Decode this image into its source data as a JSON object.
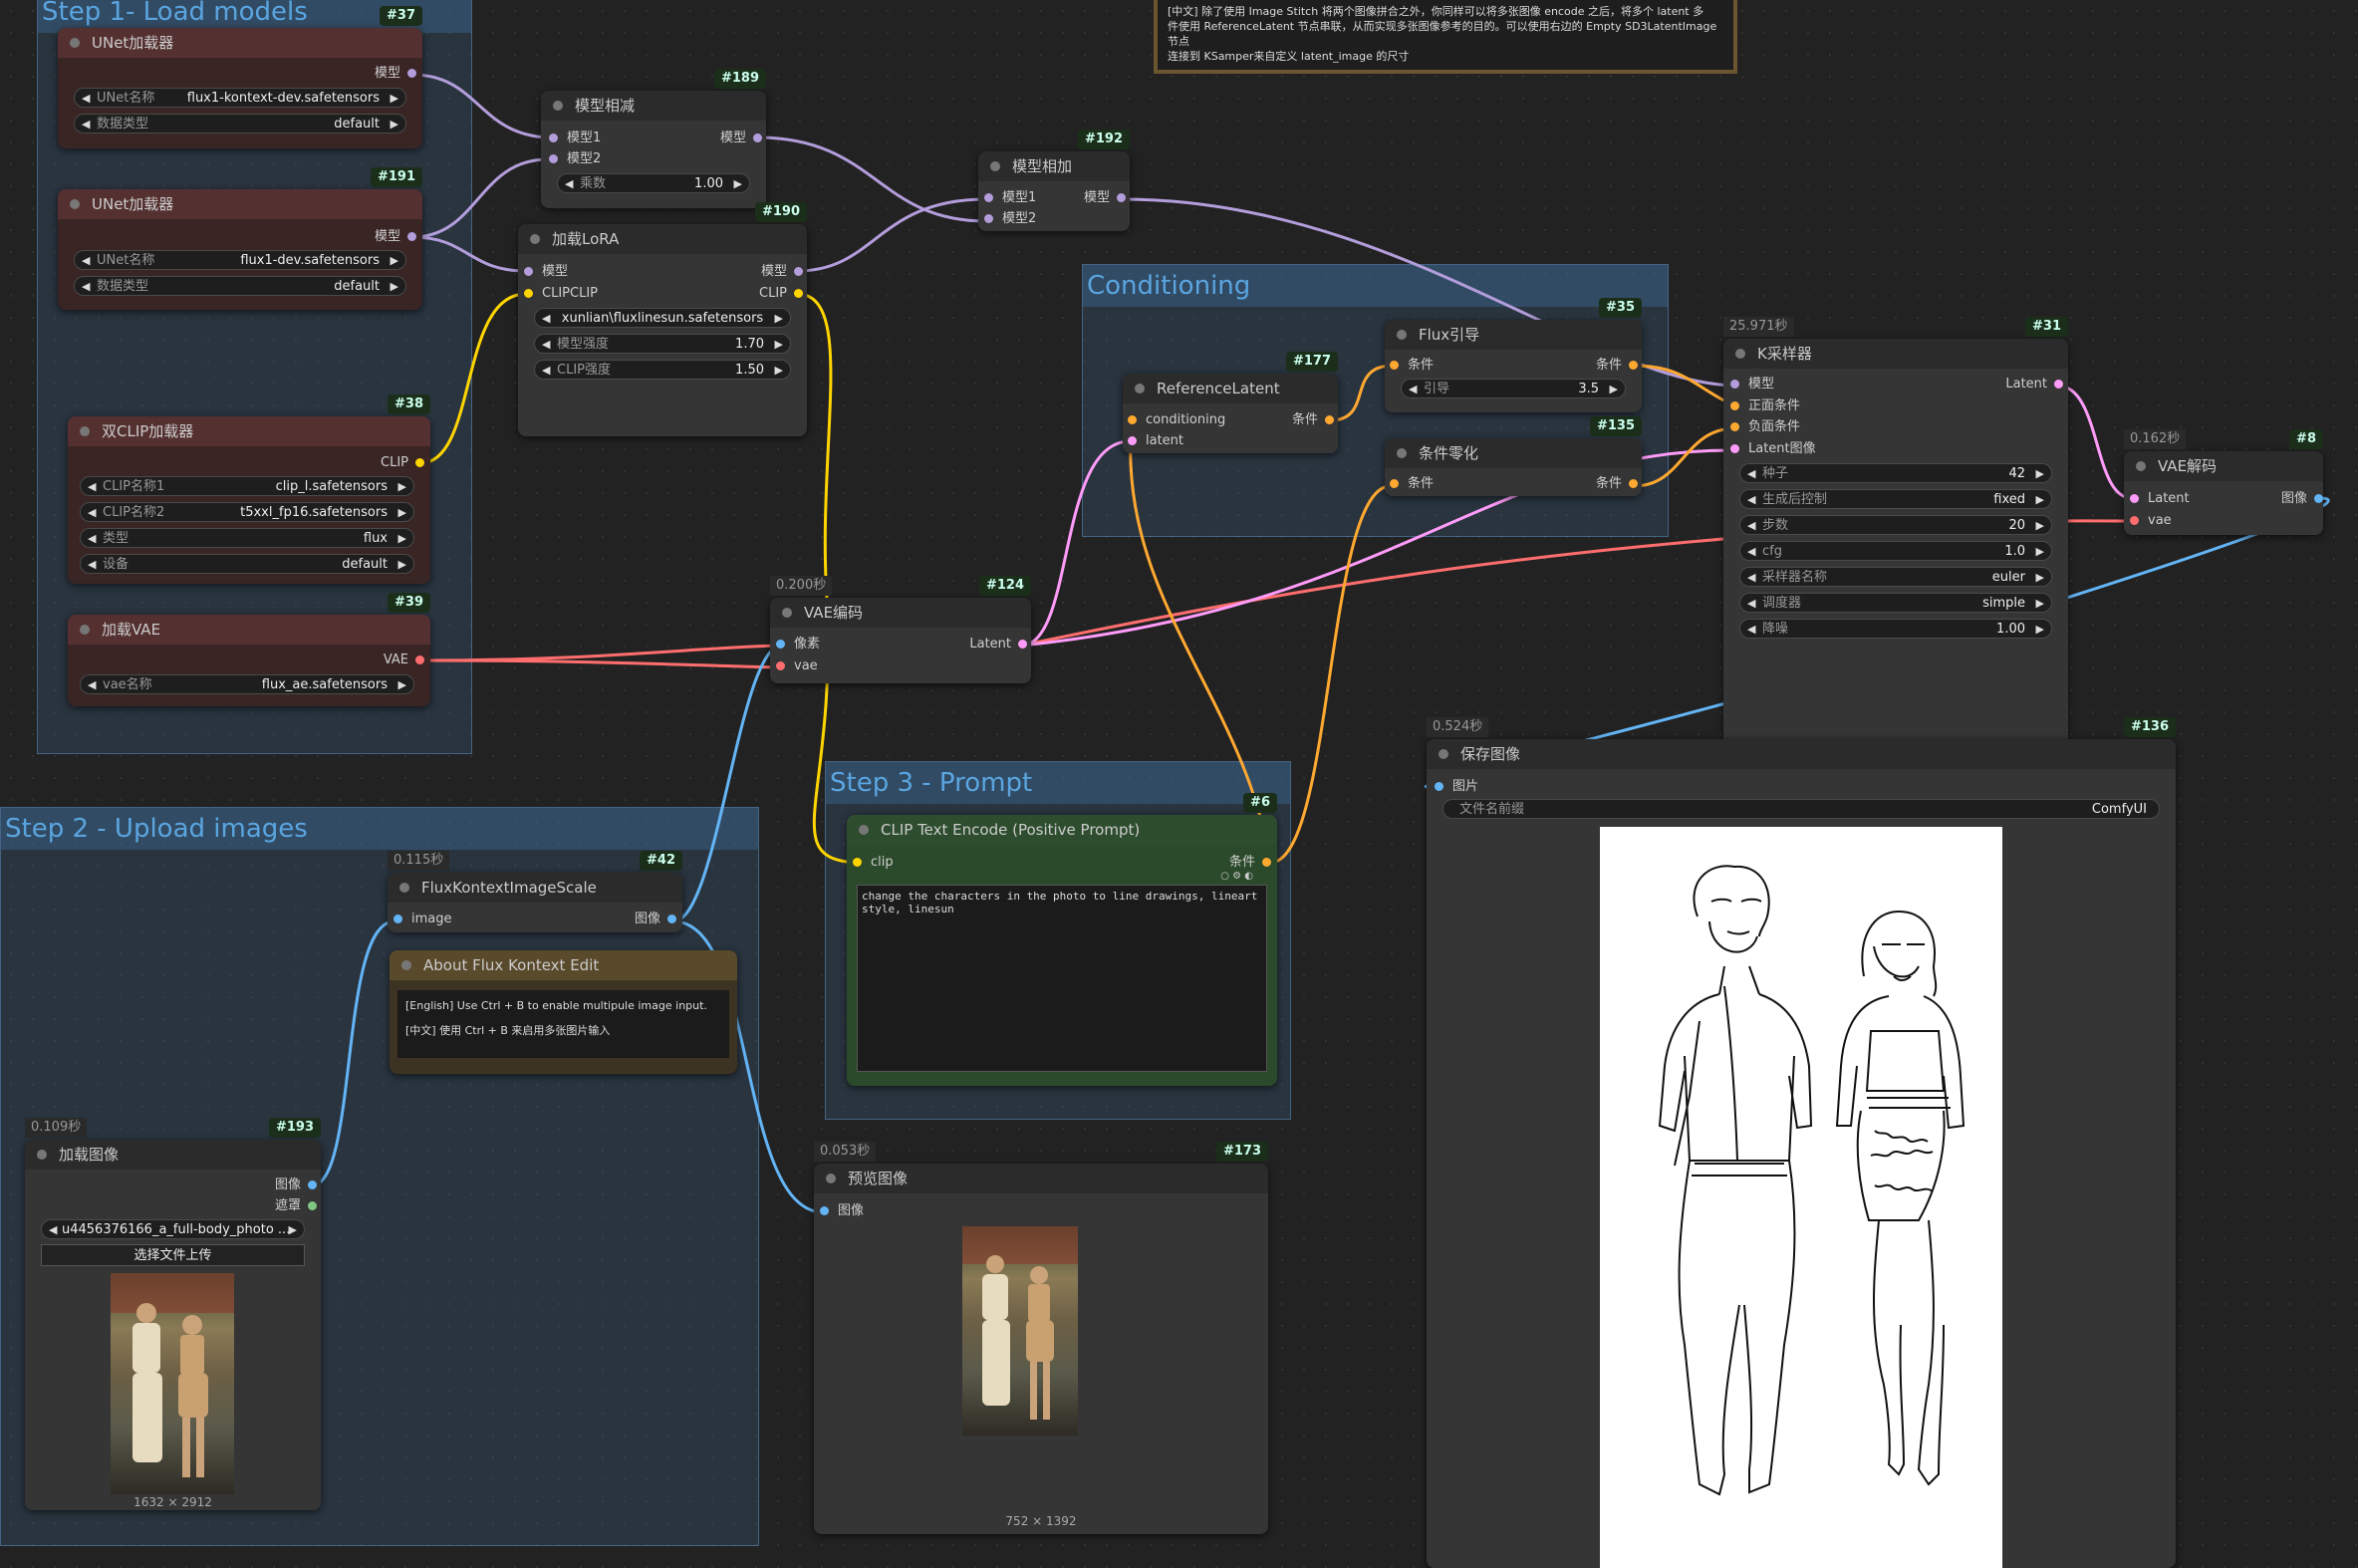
{
  "groups": {
    "g1": "Step 1- Load models",
    "g2": "Step 2 - Upload images",
    "g3": "Step 3 - Prompt",
    "g4": "Conditioning"
  },
  "top_note": {
    "line1": "[中文] 除了使用 Image Stitch 将两个图像拼合之外，你同样可以将多张图像 encode 之后，将多个 latent 多",
    "line2": "件使用 ReferenceLatent 节点串联，从而实现多张图像参考的目的。可以使用右边的 Empty SD3LatentImage 节点",
    "line3": "连接到 KSamper来自定义 latent_image 的尺寸"
  },
  "nodes": {
    "n37": {
      "id": "#37",
      "title": "UNet加载器",
      "out_model": "模型",
      "w1_label": "UNet名称",
      "w1_value": "flux1-kontext-dev.safetensors",
      "w2_label": "数据类型",
      "w2_value": "default"
    },
    "n191": {
      "id": "#191",
      "title": "UNet加载器",
      "out_model": "模型",
      "w1_label": "UNet名称",
      "w1_value": "flux1-dev.safetensors",
      "w2_label": "数据类型",
      "w2_value": "default"
    },
    "n38": {
      "id": "#38",
      "title": "双CLIP加载器",
      "out_clip": "CLIP",
      "w1_label": "CLIP名称1",
      "w1_value": "clip_l.safetensors",
      "w2_label": "CLIP名称2",
      "w2_value": "t5xxl_fp16.safetensors",
      "w3_label": "类型",
      "w3_value": "flux",
      "w4_label": "设备",
      "w4_value": "default"
    },
    "n39": {
      "id": "#39",
      "title": "加载VAE",
      "out_vae": "VAE",
      "w1_label": "vae名称",
      "w1_value": "flux_ae.safetensors"
    },
    "n189": {
      "id": "#189",
      "title": "模型相减",
      "in1": "模型1",
      "in2": "模型2",
      "out": "模型",
      "w1_label": "乘数",
      "w1_value": "1.00"
    },
    "n190": {
      "id": "#190",
      "title": "加载LoRA",
      "in1": "模型",
      "in2": "CLIPCLIP",
      "out1": "模型",
      "out2": "CLIP",
      "w1_value": "xunlian\\fluxlinesun.safetensors",
      "w2_label": "模型强度",
      "w2_value": "1.70",
      "w3_label": "CLIP强度",
      "w3_value": "1.50"
    },
    "n192": {
      "id": "#192",
      "title": "模型相加",
      "in1": "模型1",
      "in2": "模型2",
      "out": "模型"
    },
    "n124": {
      "id": "#124",
      "time": "0.200秒",
      "title": "VAE编码",
      "in1": "像素",
      "in2": "vae",
      "out": "Latent"
    },
    "n177": {
      "id": "#177",
      "title": "ReferenceLatent",
      "in1": "conditioning",
      "in2": "latent",
      "out": "条件"
    },
    "n35": {
      "id": "#35",
      "title": "Flux引导",
      "in1": "条件",
      "out": "条件",
      "w1_label": "引导",
      "w1_value": "3.5"
    },
    "n135": {
      "id": "#135",
      "title": "条件零化",
      "in1": "条件",
      "out": "条件"
    },
    "n31": {
      "id": "#31",
      "time": "25.971秒",
      "title": "K采样器",
      "in1": "模型",
      "in2": "正面条件",
      "in3": "负面条件",
      "in4": "Latent图像",
      "out": "Latent",
      "w1_label": "种子",
      "w1_value": "42",
      "w2_label": "生成后控制",
      "w2_value": "fixed",
      "w3_label": "步数",
      "w3_value": "20",
      "w4_label": "cfg",
      "w4_value": "1.0",
      "w5_label": "采样器名称",
      "w5_value": "euler",
      "w6_label": "调度器",
      "w6_value": "simple",
      "w7_label": "降噪",
      "w7_value": "1.00"
    },
    "n8": {
      "id": "#8",
      "time": "0.162秒",
      "title": "VAE解码",
      "in1": "Latent",
      "in2": "vae",
      "out": "图像"
    },
    "n136": {
      "id": "#136",
      "time": "0.524秒",
      "title": "保存图像",
      "in1": "图片",
      "w1_label": "文件名前缀",
      "w1_value": "ComfyUI"
    },
    "n42": {
      "id": "#42",
      "time": "0.115秒",
      "title": "FluxKontextImageScale",
      "in1": "image",
      "out": "图像"
    },
    "about": {
      "title": "About Flux Kontext Edit",
      "line1": "[English] Use Ctrl + B to enable multipule image input.",
      "line2": "[中文] 使用 Ctrl + B 来启用多张图片输入"
    },
    "n193": {
      "id": "#193",
      "time": "0.109秒",
      "title": "加载图像",
      "out1": "图像",
      "out2": "遮罩",
      "w1_value": "u4456376166_a_full-body_photo ...",
      "button": "选择文件上传",
      "caption": "1632 × 2912"
    },
    "n6": {
      "id": "#6",
      "title": "CLIP Text Encode (Positive Prompt)",
      "in1": "clip",
      "out": "条件",
      "prompt": "change the characters in the photo to line drawings, lineart style, linesun"
    },
    "n173": {
      "id": "#173",
      "time": "0.053秒",
      "title": "预览图像",
      "in1": "图像",
      "caption": "752 × 1392"
    }
  },
  "colors": {
    "model": "#b39ddb",
    "clip": "#ffd500",
    "vae": "#ff6e6e",
    "latent": "#ff9cf9",
    "cond": "#ffa931",
    "image": "#64b5f6",
    "mask": "#81c784"
  }
}
